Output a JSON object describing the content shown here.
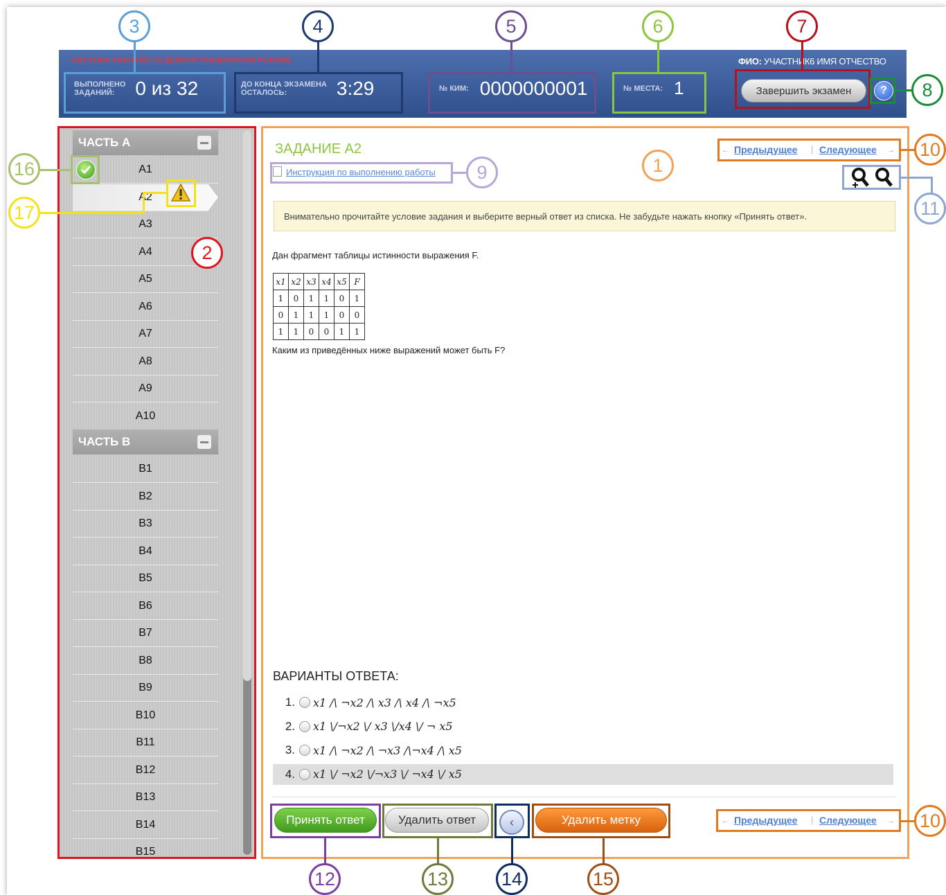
{
  "header": {
    "demo_text": "СИСТЕМА РАБОТАЕТ В ДЕМОНСТРАЦИОННОМ РЕЖИМЕ",
    "fio_label": "ФИО:",
    "fio_value": "УЧАСТНИК6 ИМЯ ОТЧЕСТВО",
    "done_label": "ВЫПОЛНЕНО\nЗАДАНИЙ:",
    "done_value": "0 из 32",
    "time_label": "ДО КОНЦА ЭКЗАМЕНА\nОСТАЛОСЬ:",
    "time_value": "3:29",
    "kim_label": "№ КИМ:",
    "kim_value": "0000000001",
    "seat_label": "№ МЕСТА:",
    "seat_value": "1",
    "finish_button": "Завершить экзамен",
    "help_button": "?"
  },
  "callouts": [
    "1",
    "2",
    "3",
    "4",
    "5",
    "6",
    "7",
    "8",
    "9",
    "10",
    "11",
    "12",
    "13",
    "14",
    "15",
    "16",
    "17"
  ],
  "sidebar": {
    "part_a": "ЧАСТЬ А",
    "part_b": "ЧАСТЬ В",
    "items_a": [
      "A1",
      "A2",
      "A3",
      "A4",
      "A5",
      "A6",
      "A7",
      "A8",
      "A9",
      "A10"
    ],
    "items_b": [
      "B1",
      "B2",
      "B3",
      "B4",
      "B5",
      "B6",
      "B7",
      "B8",
      "B9",
      "B10",
      "B11",
      "B12",
      "B13",
      "B14",
      "B15"
    ]
  },
  "content": {
    "title": "ЗАДАНИЕ А2",
    "instruction_link": "Инструкция по выполнению работы",
    "prev": "Предыдущее",
    "next": "Следующее",
    "notice": "Внимательно прочитайте условие задания и выберите верный ответ из списка. Не забудьте нажать кнопку «Принять ответ».",
    "question_intro": "Дан фрагмент таблицы истинности выражения F.",
    "question": "Каким из приведённых ниже выражений может быть F?",
    "truth_table": {
      "headers": [
        "x1",
        "x2",
        "x3",
        "x4",
        "x5",
        "F"
      ],
      "rows": [
        [
          "1",
          "0",
          "1",
          "1",
          "0",
          "1"
        ],
        [
          "0",
          "1",
          "1",
          "1",
          "0",
          "0"
        ],
        [
          "1",
          "1",
          "0",
          "0",
          "1",
          "1"
        ]
      ]
    },
    "variants_title": "ВАРИАНТЫ ОТВЕТА:",
    "variants": [
      {
        "num": "1.",
        "expr": "x1 /\\ ¬x2 /\\ x3 /\\ x4 /\\ ¬x5"
      },
      {
        "num": "2.",
        "expr": "x1 \\/¬x2 \\/ x3 \\/x4 \\/ ¬ x5"
      },
      {
        "num": "3.",
        "expr": "x1 /\\ ¬x2 /\\ ¬x3 /\\¬x4 /\\ x5"
      },
      {
        "num": "4.",
        "expr": "x1 \\/ ¬x2 \\/¬x3 \\/ ¬x4 \\/ x5"
      }
    ],
    "accept_button": "Принять ответ",
    "delete_button": "Удалить ответ",
    "mark_button": "‹",
    "unmark_button": "Удалить метку",
    "nav_arrow_left": "←",
    "nav_arrow_right": "→",
    "nav_divider": "|"
  },
  "colors": {
    "c1": "#f0a15a",
    "c2": "#e0141e",
    "c3": "#5a9fd8",
    "c4": "#1e3a6e",
    "c5": "#6b4f8f",
    "c6": "#8cc63f",
    "c7": "#b4121c",
    "c8": "#1a8c3a",
    "c9": "#b7a7d6",
    "c10": "#e07a1e",
    "c11": "#8da6cf",
    "c12": "#7b3fa0",
    "c13": "#6d7a3c",
    "c14": "#0f2c5e",
    "c15": "#a04f14",
    "c16": "#a7c070",
    "c17": "#f5e11a"
  }
}
